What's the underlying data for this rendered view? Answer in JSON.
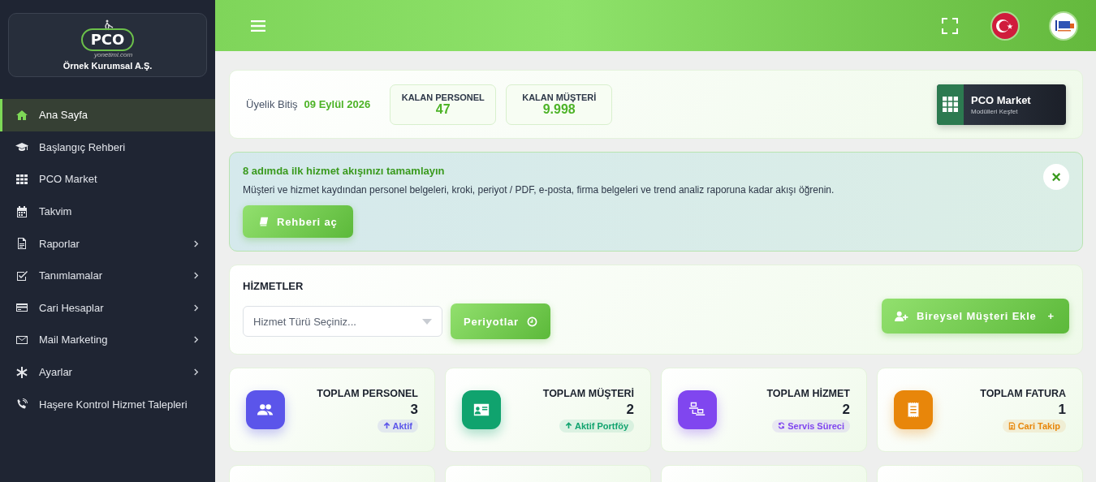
{
  "brand": {
    "logo_text": "PCO",
    "logo_domain": "yonetimi.com",
    "company": "Örnek Kurumsal A.Ş."
  },
  "sidebar": {
    "items": [
      {
        "label": "Ana Sayfa",
        "selected": true,
        "expandable": false
      },
      {
        "label": "Başlangıç Rehberi",
        "selected": false,
        "expandable": false
      },
      {
        "label": "PCO Market",
        "selected": false,
        "expandable": false
      },
      {
        "label": "Takvim",
        "selected": false,
        "expandable": false
      },
      {
        "label": "Raporlar",
        "selected": false,
        "expandable": true
      },
      {
        "label": "Tanımlamalar",
        "selected": false,
        "expandable": true
      },
      {
        "label": "Cari Hesaplar",
        "selected": false,
        "expandable": true
      },
      {
        "label": "Mail Marketing",
        "selected": false,
        "expandable": true
      },
      {
        "label": "Ayarlar",
        "selected": false,
        "expandable": true
      },
      {
        "label": "Haşere Kontrol Hizmet Talepleri",
        "selected": false,
        "expandable": false
      }
    ]
  },
  "membership": {
    "label": "Üyelik Bitiş",
    "date": "09 Eylül 2026",
    "counters": [
      {
        "label": "KALAN PERSONEL",
        "value": "47"
      },
      {
        "label": "KALAN MÜŞTERİ",
        "value": "9.998"
      }
    ],
    "market_button": {
      "title": "PCO Market",
      "subtitle": "Modülleri Keşfet"
    }
  },
  "guide": {
    "title": "8 adımda ilk hizmet akışınızı tamamlayın",
    "text": "Müşteri ve hizmet kaydından personel belgeleri, kroki, periyot / PDF, e-posta, firma belgeleri ve trend analiz raporuna kadar akışı öğrenin.",
    "button": "Rehberi aç",
    "close": "×"
  },
  "services": {
    "title": "HİZMETLER",
    "select": {
      "placeholder": "Hizmet Türü Seçiniz..."
    },
    "periods_button": "Periyotlar",
    "add_button": "Bireysel Müşteri Ekle",
    "add_symbol": "+"
  },
  "stats": [
    {
      "label": "TOPLAM PERSONEL",
      "value": "3",
      "badge": "Aktif",
      "color": "#5b55ea"
    },
    {
      "label": "TOPLAM MÜŞTERİ",
      "value": "2",
      "badge": "Aktif Portföy",
      "color": "#10a36e"
    },
    {
      "label": "TOPLAM HİZMET",
      "value": "2",
      "badge": "Servis Süreci",
      "color": "#8046ef"
    },
    {
      "label": "TOPLAM FATURA",
      "value": "1",
      "badge": "Cari Takip",
      "color": "#e8860a"
    }
  ]
}
